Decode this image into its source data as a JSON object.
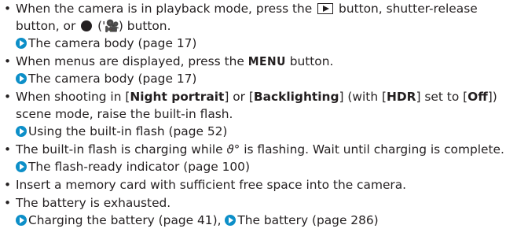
{
  "bullet_char": "•",
  "items": [
    {
      "l1_pre": "When the camera is in playback mode, press the ",
      "l1_post": " button, shutter-release",
      "l2_pre": "button, or ",
      "l2_open": " (",
      "l2_movie_glyph": "ꞌ🎥",
      "l2_close": ") button.",
      "ref": "The camera body (page 17)"
    },
    {
      "pre": "When menus are displayed, press the ",
      "menu_word": "MENU",
      "post": " button.",
      "ref": "The camera body (page 17)"
    },
    {
      "p1": "When shooting in [",
      "b1": "Night portrait",
      "p2": "] or [",
      "b2": "Backlighting",
      "p3": "] (with [",
      "b3": "HDR",
      "p4": "] set to [",
      "b4": "Off",
      "p5": "])",
      "line2": "scene mode, raise the built-in flash.",
      "ref": "Using the built-in flash (page 52)"
    },
    {
      "pre": "The built-in flash is charging while ",
      "flash_glyph": "ϑ°",
      "post": " is flashing. Wait until charging is complete.",
      "ref": "The flash-ready indicator (page 100)"
    },
    {
      "text": "Insert a memory card with sufficient free space into the camera."
    },
    {
      "text": "The battery is exhausted.",
      "ref1": "Charging the battery (page 41), ",
      "ref2": "The battery (page 286)"
    }
  ],
  "colors": {
    "text": "#231f20",
    "arrow": "#0d8fc8"
  },
  "icons": [
    "arrow-link-icon",
    "play-button-icon",
    "record-dot-icon",
    "movie-icon",
    "flash-icon"
  ]
}
